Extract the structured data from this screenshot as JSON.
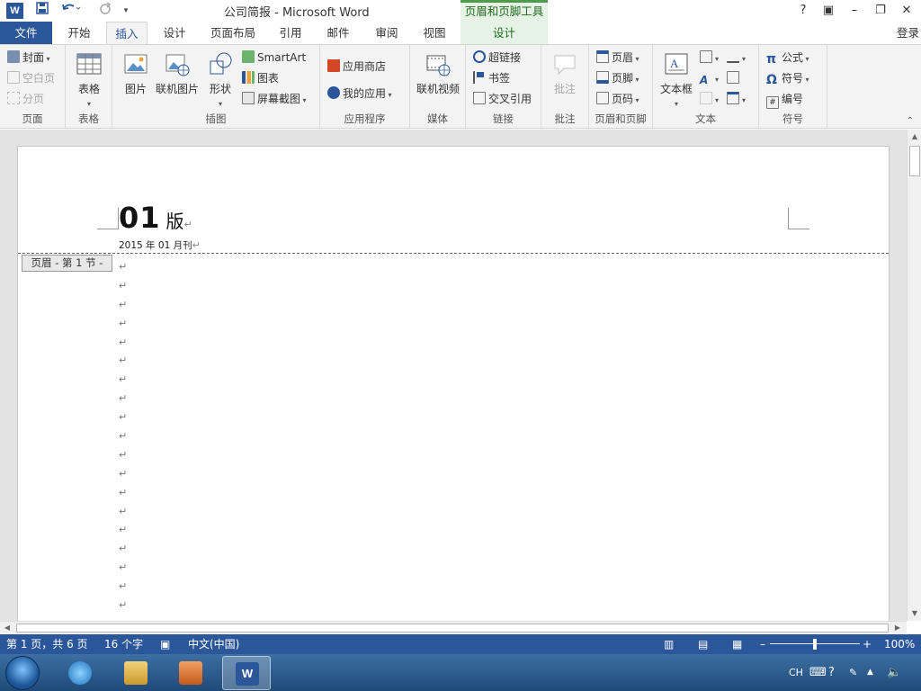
{
  "window": {
    "title": "公司简报 - Microsoft Word",
    "context_tab_group": "页眉和页脚工具",
    "app_logo_letter": "W",
    "login": "登录"
  },
  "qat": {
    "save_icon": "save-icon",
    "undo_icon": "undo-icon",
    "redo_icon": "redo-icon",
    "customize_icon": "customize-qat-icon"
  },
  "window_controls": {
    "help": "?",
    "ribbon_options": "▣",
    "minimize": "–",
    "restore": "❐",
    "close": "✕"
  },
  "tabs": {
    "file": "文件",
    "items": [
      "开始",
      "插入",
      "设计",
      "页面布局",
      "引用",
      "邮件",
      "审阅",
      "视图"
    ],
    "active": "插入",
    "context_design": "设计"
  },
  "ribbon": {
    "pages": {
      "label": "页面",
      "cover": "封面",
      "blank_page": "空白页",
      "page_break": "分页"
    },
    "tables": {
      "label": "表格",
      "table": "表格"
    },
    "illustrations": {
      "label": "插图",
      "pictures": "图片",
      "online_pictures": "联机图片",
      "shapes": "形状",
      "smartart": "SmartArt",
      "chart": "图表",
      "screenshot": "屏幕截图"
    },
    "apps": {
      "label": "应用程序",
      "store": "应用商店",
      "my_apps": "我的应用"
    },
    "media": {
      "label": "媒体",
      "online_video": "联机视频"
    },
    "links": {
      "label": "链接",
      "hyperlink": "超链接",
      "bookmark": "书签",
      "cross_reference": "交叉引用"
    },
    "comments": {
      "label": "批注",
      "comment": "批注"
    },
    "header_footer": {
      "label": "页眉和页脚",
      "header": "页眉",
      "footer": "页脚",
      "page_number": "页码"
    },
    "text": {
      "label": "文本",
      "text_box": "文本框"
    },
    "symbols": {
      "label": "符号",
      "equation": "公式",
      "symbol": "符号",
      "number": "编号"
    }
  },
  "document": {
    "header_number": "01",
    "header_edition": "版",
    "header_date": "2015 年 01 月刊",
    "header_section_label": "页眉 - 第 1 节 -",
    "paragraph_mark": "↵",
    "paragraph_count": 20
  },
  "statusbar": {
    "page": "第 1 页，共 6 页",
    "words": "16 个字",
    "language": "中文(中国)",
    "zoom": "100%",
    "zoom_minus": "–",
    "zoom_plus": "+"
  },
  "taskbar": {
    "tray_lang": "CH",
    "apps": [
      "internet-explorer-icon",
      "file-explorer-icon",
      "media-player-icon",
      "word-icon"
    ]
  },
  "colors": {
    "word_blue": "#2b579a",
    "context_green": "#4f9a4f",
    "ribbon_bg": "#f3f3f3"
  }
}
